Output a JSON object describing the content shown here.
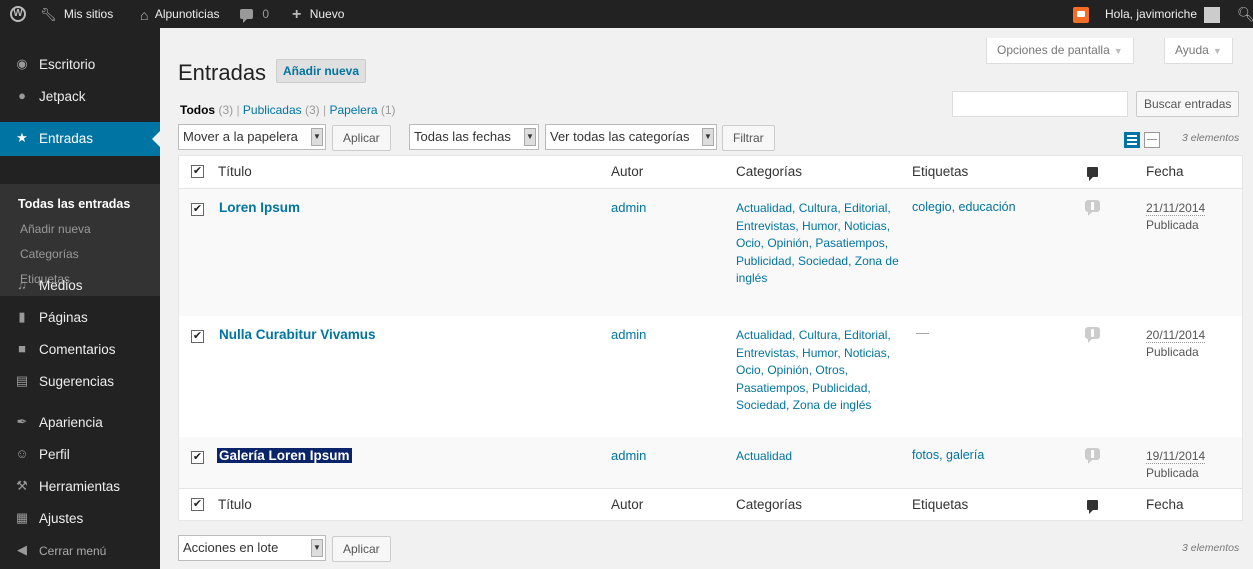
{
  "adminbar": {
    "my_sites": "Mis sitios",
    "site_name": "Alpunoticias",
    "comments_count": "0",
    "new_label": "Nuevo",
    "greeting": "Hola, javimoriche"
  },
  "sidebar": {
    "items": [
      {
        "label": "Escritorio",
        "icon": "dashboard-icon"
      },
      {
        "label": "Jetpack",
        "icon": "jetpack-icon"
      },
      {
        "label": "Entradas",
        "icon": "pin-icon"
      },
      {
        "label": "Medios",
        "icon": "media-icon"
      },
      {
        "label": "Páginas",
        "icon": "pages-icon"
      },
      {
        "label": "Comentarios",
        "icon": "comments-icon"
      },
      {
        "label": "Sugerencias",
        "icon": "feedback-icon"
      },
      {
        "label": "Apariencia",
        "icon": "appearance-icon"
      },
      {
        "label": "Perfil",
        "icon": "profile-icon"
      },
      {
        "label": "Herramientas",
        "icon": "tools-icon"
      },
      {
        "label": "Ajustes",
        "icon": "settings-icon"
      },
      {
        "label": "Cerrar menú",
        "icon": "collapse-icon"
      }
    ],
    "submenu": [
      "Todas las entradas",
      "Añadir nueva",
      "Categorías",
      "Etiquetas"
    ]
  },
  "screen_options": "Opciones de pantalla",
  "help": "Ayuda",
  "page_title": "Entradas",
  "add_new": "Añadir nueva",
  "filters": {
    "all": "Todos",
    "all_count": "(3)",
    "published": "Publicadas",
    "published_count": "(3)",
    "trash": "Papelera",
    "trash_count": "(1)"
  },
  "search_button": "Buscar entradas",
  "bulk_top": "Mover a la papelera",
  "apply": "Aplicar",
  "dates_select": "Todas las fechas",
  "categories_select": "Ver todas las categorías",
  "filter_button": "Filtrar",
  "items_count": "3 elementos",
  "bulk_bottom": "Acciones en lote",
  "columns": {
    "title": "Título",
    "author": "Autor",
    "categories": "Categorías",
    "tags": "Etiquetas",
    "date": "Fecha"
  },
  "posts": [
    {
      "title": "Loren Ipsum",
      "author": "admin",
      "categories": "Actualidad, Cultura, Editorial, Entrevistas, Humor, Noticias, Ocio, Opinión, Pasatiempos, Publicidad, Sociedad, Zona de inglés",
      "tags": "colegio, educación",
      "date": "21/11/2014",
      "status": "Publicada"
    },
    {
      "title": "Nulla Curabitur Vivamus",
      "author": "admin",
      "categories": "Actualidad, Cultura, Editorial, Entrevistas, Humor, Noticias, Ocio, Opinión, Otros, Pasatiempos, Publicidad, Sociedad, Zona de inglés",
      "tags": "—",
      "date": "20/11/2014",
      "status": "Publicada"
    },
    {
      "title": "Galería Loren Ipsum",
      "author": "admin",
      "categories": "Actualidad",
      "tags": "fotos, galería",
      "date": "19/11/2014",
      "status": "Publicada"
    }
  ],
  "colors": {
    "adminbar_bg": "#222222",
    "accent": "#0074a2",
    "notification": "#f56e28"
  }
}
